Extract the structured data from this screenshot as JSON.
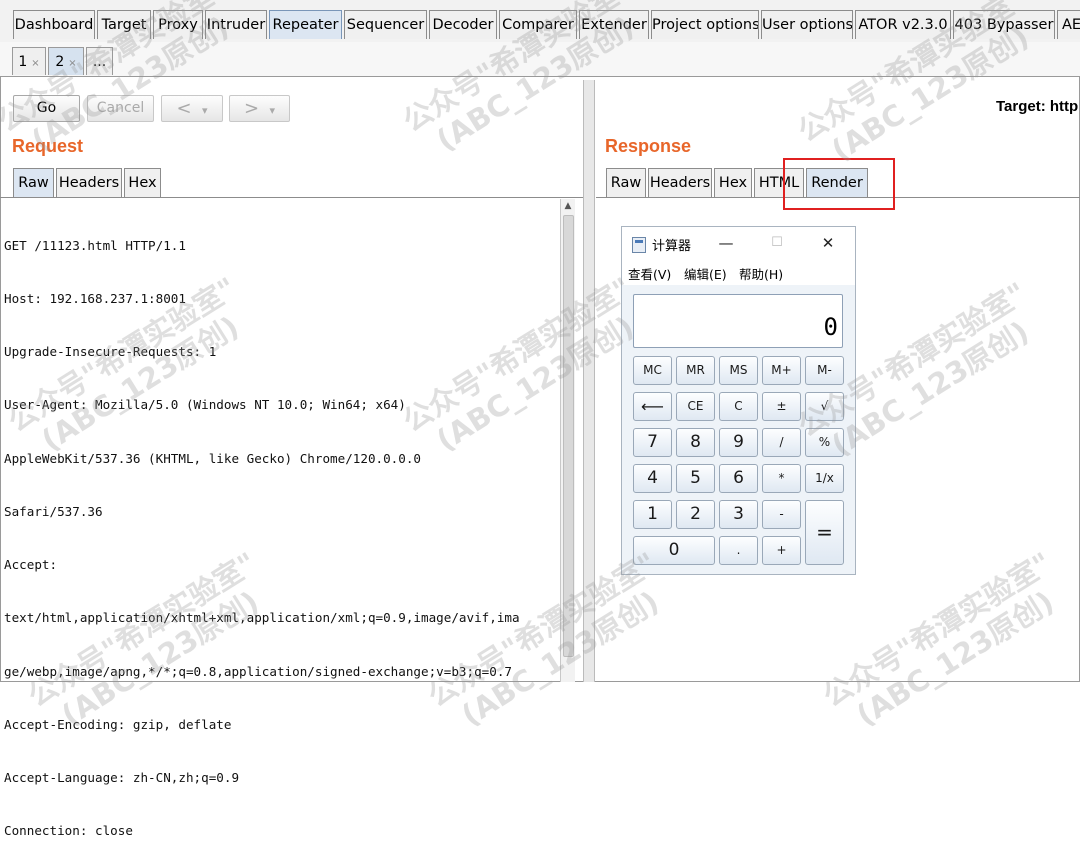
{
  "main_tabs": [
    "Dashboard",
    "Target",
    "Proxy",
    "Intruder",
    "Repeater",
    "Sequencer",
    "Decoder",
    "Comparer",
    "Extender",
    "Project options",
    "User options",
    "ATOR v2.3.0",
    "403 Bypasser",
    "AE"
  ],
  "active_main_tab": "Repeater",
  "repeater_tabs": [
    {
      "label": "1",
      "close": "×"
    },
    {
      "label": "2",
      "close": "×"
    },
    {
      "label": "..."
    }
  ],
  "toolbar": {
    "go": "Go",
    "cancel": "Cancel",
    "back": "<",
    "forward": ">",
    "dropdown": "▾",
    "target": "Target: http"
  },
  "request": {
    "title": "Request",
    "tabs": [
      "Raw",
      "Headers",
      "Hex"
    ],
    "lines": [
      "GET /11123.html HTTP/1.1",
      "Host: 192.168.237.1:8001",
      "Upgrade-Insecure-Requests: 1",
      "User-Agent: Mozilla/5.0 (Windows NT 10.0; Win64; x64)",
      "AppleWebKit/537.36 (KHTML, like Gecko) Chrome/120.0.0.0",
      "Safari/537.36",
      "Accept:",
      "text/html,application/xhtml+xml,application/xml;q=0.9,image/avif,ima",
      "ge/webp,image/apng,*/*;q=0.8,application/signed-exchange;v=b3;q=0.7",
      "Accept-Encoding: gzip, deflate",
      "Accept-Language: zh-CN,zh;q=0.9",
      "Connection: close"
    ]
  },
  "response": {
    "title": "Response",
    "tabs": [
      "Raw",
      "Headers",
      "Hex",
      "HTML",
      "Render"
    ],
    "active_tab": "Render"
  },
  "calculator": {
    "title": "计算器",
    "window_buttons": [
      "—",
      "☐",
      "✕"
    ],
    "menu": [
      "查看(V)",
      "编辑(E)",
      "帮助(H)"
    ],
    "display": "0",
    "keys": {
      "mc": "MC",
      "mr": "MR",
      "ms": "MS",
      "mplus": "M+",
      "mminus": "M-",
      "back": "⟵",
      "ce": "CE",
      "c": "C",
      "pm": "±",
      "sqrt": "√",
      "k7": "7",
      "k8": "8",
      "k9": "9",
      "div": "/",
      "pct": "%",
      "k4": "4",
      "k5": "5",
      "k6": "6",
      "mul": "*",
      "inv": "1/x",
      "k1": "1",
      "k2": "2",
      "k3": "3",
      "sub": "-",
      "eq": "=",
      "k0": "0",
      "dot": ".",
      "add": "+"
    }
  },
  "watermark": {
    "line1": "公众号\"希潭实验室\"",
    "line2": "(ABC_123原创)"
  }
}
